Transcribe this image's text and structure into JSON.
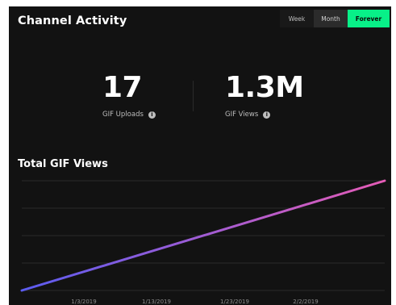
{
  "header": {
    "title": "Channel Activity",
    "tabs": [
      {
        "label": "Week",
        "active": false
      },
      {
        "label": "Month",
        "active": false
      },
      {
        "label": "Forever",
        "active": true
      }
    ]
  },
  "stats": {
    "uploads": {
      "value": "17",
      "label": "GIF Uploads",
      "icon": "info-icon"
    },
    "views": {
      "value": "1.3M",
      "label": "GIF Views",
      "icon": "info-icon"
    }
  },
  "colors": {
    "panel_background": "#121212",
    "accent_green": "#08f088",
    "line_start": "#5b5cf0",
    "line_end": "#e55cb6"
  },
  "chart_data": {
    "type": "line",
    "title": "Total GIF Views",
    "xlabel": "",
    "ylabel": "",
    "x": [
      "1/3/2019",
      "1/13/2019",
      "1/23/2019",
      "2/2/2019"
    ],
    "series": [
      {
        "values": [
          240000,
          520000,
          800000,
          1080000
        ]
      }
    ],
    "line_endpoints": {
      "start": 0,
      "end": 1300000
    },
    "ylim": [
      0,
      1300000
    ],
    "grid": true,
    "legend": "none"
  }
}
